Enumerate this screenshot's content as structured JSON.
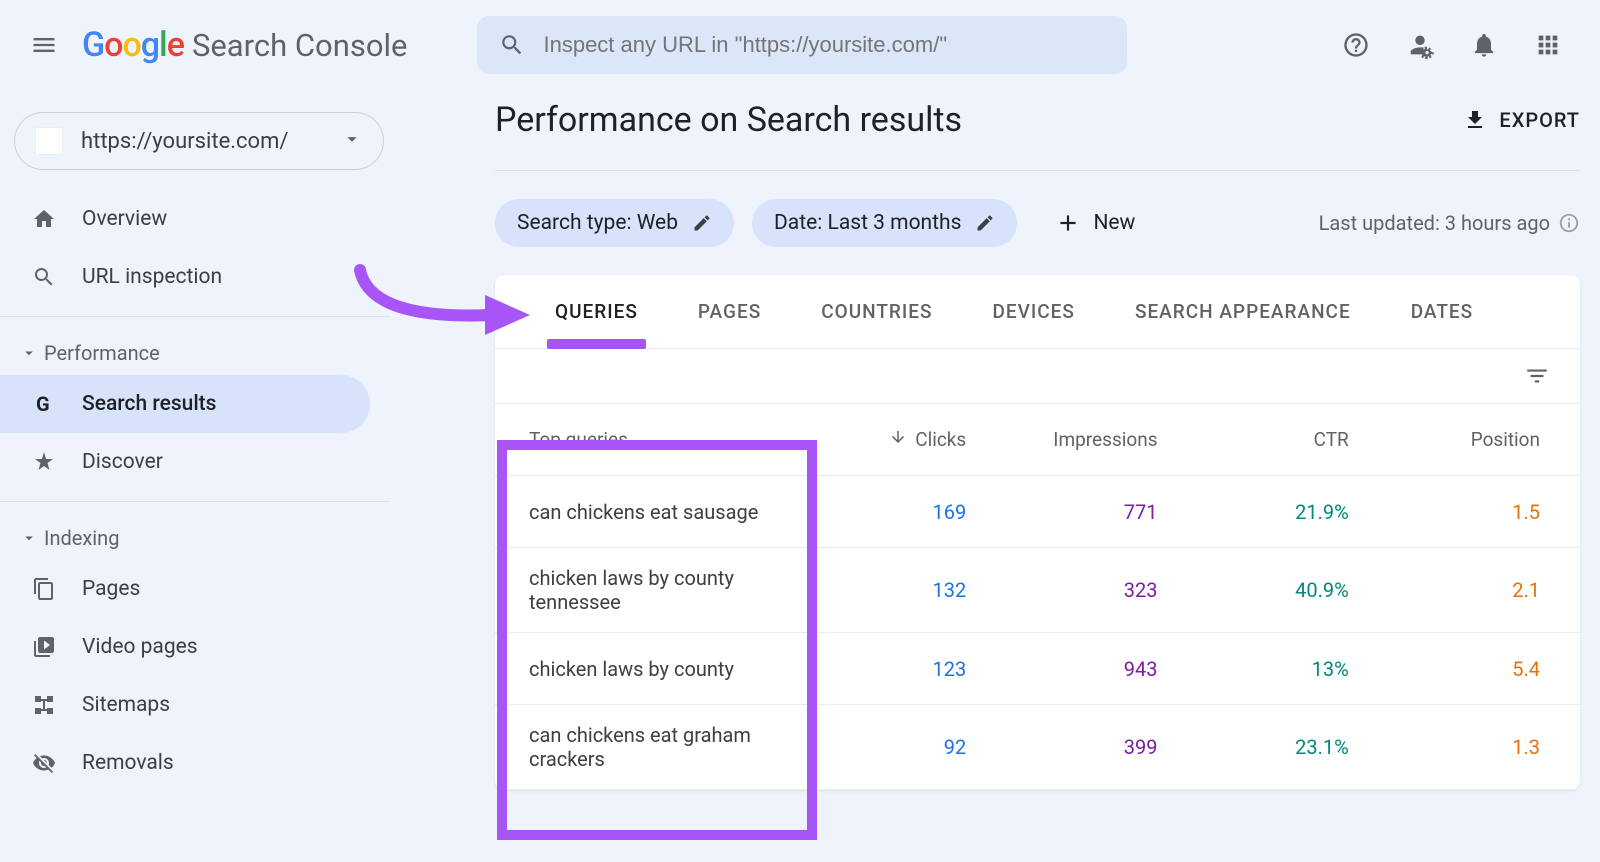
{
  "header": {
    "app_title": "Search Console",
    "search_placeholder": "Inspect any URL in \"https://yoursite.com/\""
  },
  "sidebar": {
    "property": "https://yoursite.com/",
    "items": {
      "overview": "Overview",
      "url_inspection": "URL inspection",
      "performance_section": "Performance",
      "search_results": "Search results",
      "discover": "Discover",
      "indexing_section": "Indexing",
      "pages": "Pages",
      "video_pages": "Video pages",
      "sitemaps": "Sitemaps",
      "removals": "Removals"
    }
  },
  "main": {
    "page_title": "Performance on Search results",
    "export_label": "EXPORT",
    "chip_search_type": "Search type: Web",
    "chip_date": "Date: Last 3 months",
    "new_label": "New",
    "last_updated": "Last updated: 3 hours ago"
  },
  "tabs": {
    "queries": "QUERIES",
    "pages": "PAGES",
    "countries": "COUNTRIES",
    "devices": "DEVICES",
    "search_appearance": "SEARCH APPEARANCE",
    "dates": "DATES"
  },
  "table": {
    "header": {
      "top_queries": "Top queries",
      "clicks": "Clicks",
      "impressions": "Impressions",
      "ctr": "CTR",
      "position": "Position"
    },
    "rows": [
      {
        "query": "can chickens eat sausage",
        "clicks": "169",
        "impressions": "771",
        "ctr": "21.9%",
        "position": "1.5"
      },
      {
        "query": "chicken laws by county tennessee",
        "clicks": "132",
        "impressions": "323",
        "ctr": "40.9%",
        "position": "2.1"
      },
      {
        "query": "chicken laws by county",
        "clicks": "123",
        "impressions": "943",
        "ctr": "13%",
        "position": "5.4"
      },
      {
        "query": "can chickens eat graham crackers",
        "clicks": "92",
        "impressions": "399",
        "ctr": "23.1%",
        "position": "1.3"
      }
    ]
  }
}
